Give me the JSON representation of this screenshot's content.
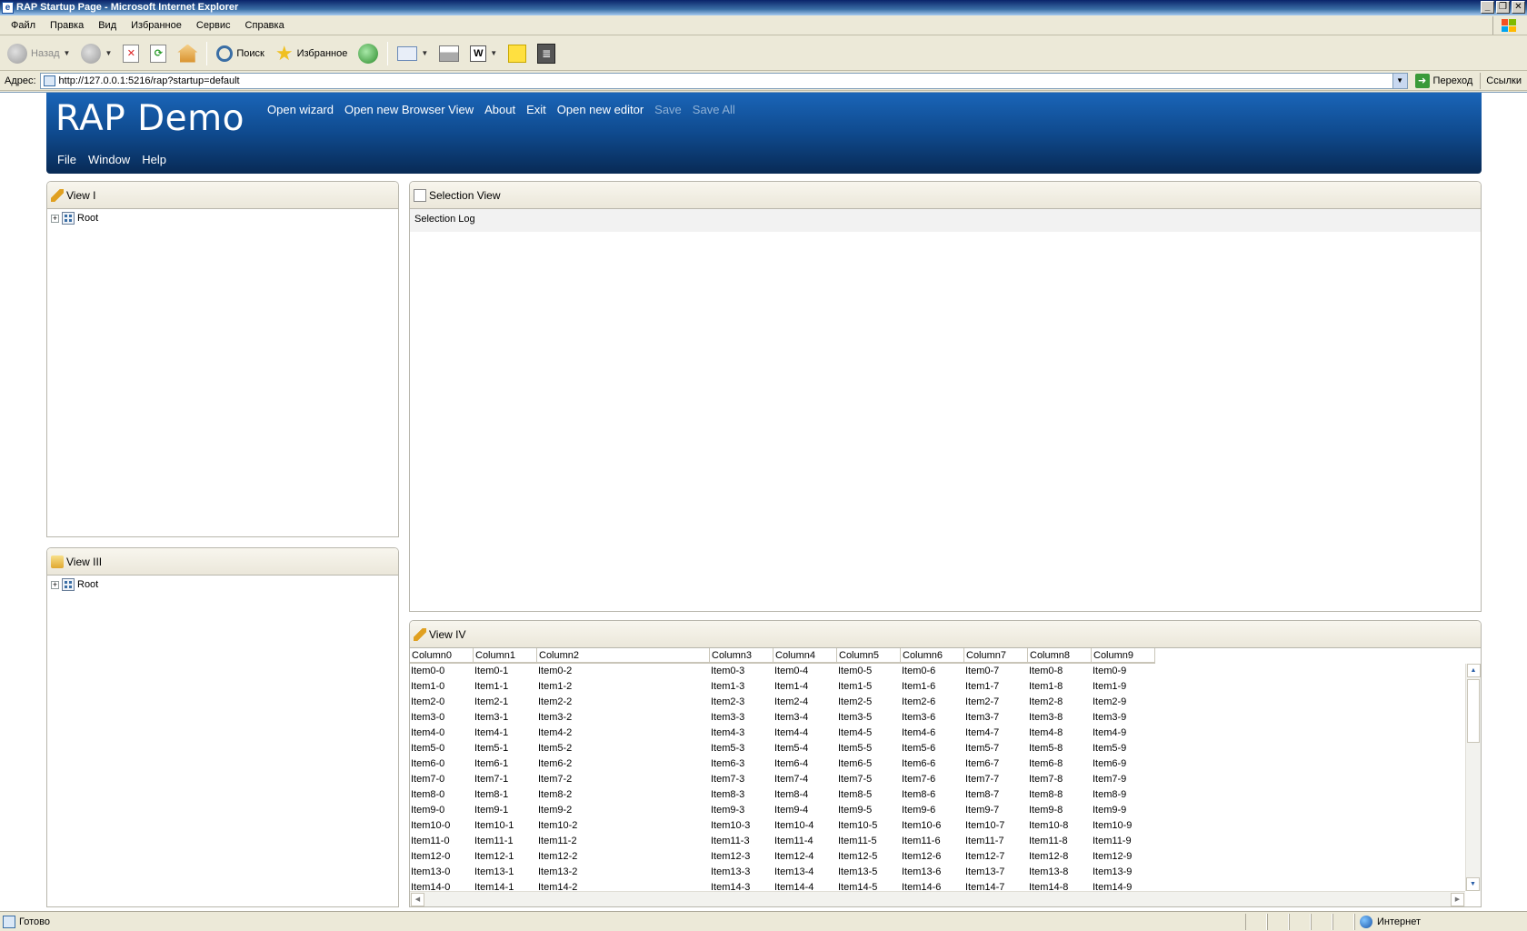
{
  "window": {
    "title": "RAP Startup Page - Microsoft Internet Explorer"
  },
  "menubar": [
    "Файл",
    "Правка",
    "Вид",
    "Избранное",
    "Сервис",
    "Справка"
  ],
  "toolbar": {
    "back_label": "Назад",
    "search_label": "Поиск",
    "favorites_label": "Избранное"
  },
  "address": {
    "label": "Адрес:",
    "url": "http://127.0.0.1:5216/rap?startup=default",
    "go_label": "Переход",
    "links_label": "Ссылки"
  },
  "rap": {
    "title": "RAP Demo",
    "actions": [
      {
        "label": "Open wizard",
        "enabled": true
      },
      {
        "label": "Open new Browser View",
        "enabled": true
      },
      {
        "label": "About",
        "enabled": true
      },
      {
        "label": "Exit",
        "enabled": true
      },
      {
        "label": "Open new editor",
        "enabled": true
      },
      {
        "label": "Save",
        "enabled": false
      },
      {
        "label": "Save All",
        "enabled": false
      }
    ],
    "menu": [
      "File",
      "Window",
      "Help"
    ]
  },
  "views": {
    "view1": {
      "title": "View I",
      "root_label": "Root"
    },
    "view3": {
      "title": "View III",
      "root_label": "Root"
    },
    "selection": {
      "title": "Selection View",
      "log_label": "Selection Log"
    },
    "view4": {
      "title": "View IV",
      "columns": [
        "Column0",
        "Column1",
        "Column2",
        "Column3",
        "Column4",
        "Column5",
        "Column6",
        "Column7",
        "Column8",
        "Column9"
      ],
      "rows": [
        [
          "Item0-0",
          "Item0-1",
          "Item0-2",
          "Item0-3",
          "Item0-4",
          "Item0-5",
          "Item0-6",
          "Item0-7",
          "Item0-8",
          "Item0-9"
        ],
        [
          "Item1-0",
          "Item1-1",
          "Item1-2",
          "Item1-3",
          "Item1-4",
          "Item1-5",
          "Item1-6",
          "Item1-7",
          "Item1-8",
          "Item1-9"
        ],
        [
          "Item2-0",
          "Item2-1",
          "Item2-2",
          "Item2-3",
          "Item2-4",
          "Item2-5",
          "Item2-6",
          "Item2-7",
          "Item2-8",
          "Item2-9"
        ],
        [
          "Item3-0",
          "Item3-1",
          "Item3-2",
          "Item3-3",
          "Item3-4",
          "Item3-5",
          "Item3-6",
          "Item3-7",
          "Item3-8",
          "Item3-9"
        ],
        [
          "Item4-0",
          "Item4-1",
          "Item4-2",
          "Item4-3",
          "Item4-4",
          "Item4-5",
          "Item4-6",
          "Item4-7",
          "Item4-8",
          "Item4-9"
        ],
        [
          "Item5-0",
          "Item5-1",
          "Item5-2",
          "Item5-3",
          "Item5-4",
          "Item5-5",
          "Item5-6",
          "Item5-7",
          "Item5-8",
          "Item5-9"
        ],
        [
          "Item6-0",
          "Item6-1",
          "Item6-2",
          "Item6-3",
          "Item6-4",
          "Item6-5",
          "Item6-6",
          "Item6-7",
          "Item6-8",
          "Item6-9"
        ],
        [
          "Item7-0",
          "Item7-1",
          "Item7-2",
          "Item7-3",
          "Item7-4",
          "Item7-5",
          "Item7-6",
          "Item7-7",
          "Item7-8",
          "Item7-9"
        ],
        [
          "Item8-0",
          "Item8-1",
          "Item8-2",
          "Item8-3",
          "Item8-4",
          "Item8-5",
          "Item8-6",
          "Item8-7",
          "Item8-8",
          "Item8-9"
        ],
        [
          "Item9-0",
          "Item9-1",
          "Item9-2",
          "Item9-3",
          "Item9-4",
          "Item9-5",
          "Item9-6",
          "Item9-7",
          "Item9-8",
          "Item9-9"
        ],
        [
          "Item10-0",
          "Item10-1",
          "Item10-2",
          "Item10-3",
          "Item10-4",
          "Item10-5",
          "Item10-6",
          "Item10-7",
          "Item10-8",
          "Item10-9"
        ],
        [
          "Item11-0",
          "Item11-1",
          "Item11-2",
          "Item11-3",
          "Item11-4",
          "Item11-5",
          "Item11-6",
          "Item11-7",
          "Item11-8",
          "Item11-9"
        ],
        [
          "Item12-0",
          "Item12-1",
          "Item12-2",
          "Item12-3",
          "Item12-4",
          "Item12-5",
          "Item12-6",
          "Item12-7",
          "Item12-8",
          "Item12-9"
        ],
        [
          "Item13-0",
          "Item13-1",
          "Item13-2",
          "Item13-3",
          "Item13-4",
          "Item13-5",
          "Item13-6",
          "Item13-7",
          "Item13-8",
          "Item13-9"
        ],
        [
          "Item14-0",
          "Item14-1",
          "Item14-2",
          "Item14-3",
          "Item14-4",
          "Item14-5",
          "Item14-6",
          "Item14-7",
          "Item14-8",
          "Item14-9"
        ]
      ]
    }
  },
  "status": {
    "text": "Готово",
    "zone": "Интернет"
  }
}
